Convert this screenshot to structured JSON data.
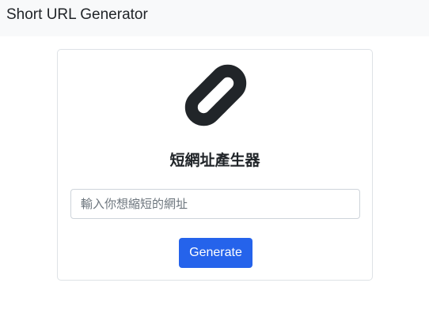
{
  "navbar": {
    "brand": "Short URL Generator"
  },
  "card": {
    "logo_icon": "link-icon",
    "title": "短網址產生器",
    "input_placeholder": "輸入你想縮短的網址",
    "input_value": "",
    "button_label": "Generate"
  },
  "colors": {
    "navbar_bg": "#f8f9fa",
    "primary": "#2563eb",
    "icon": "#212529",
    "border": "#dee2e6"
  }
}
